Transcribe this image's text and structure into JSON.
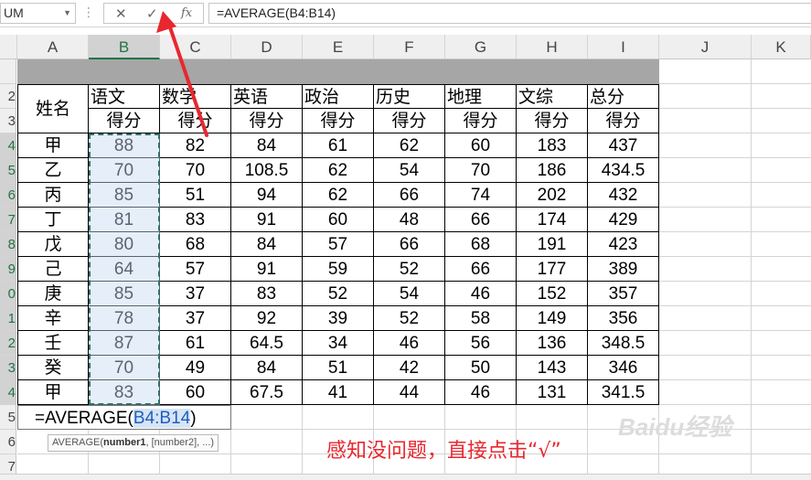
{
  "formula_bar": {
    "name_box": "UM",
    "cancel_symbol": "✕",
    "enter_symbol": "✓",
    "fx_symbol": "fx",
    "formula": "=AVERAGE(B4:B14)"
  },
  "sheet": {
    "columns": [
      "A",
      "B",
      "C",
      "D",
      "E",
      "F",
      "G",
      "H",
      "I",
      "J",
      "K"
    ],
    "row_numbers": [
      "2",
      "3",
      "4",
      "5",
      "6",
      "7",
      "8",
      "9",
      "0",
      "1",
      "2",
      "3",
      "4",
      "5",
      "6",
      "7"
    ],
    "name_header": "姓名",
    "subjects": [
      "语文",
      "数学",
      "英语",
      "政治",
      "历史",
      "地理",
      "文综",
      "总分"
    ],
    "score_label": "得分",
    "rows": [
      {
        "name": "甲",
        "values": [
          "88",
          "82",
          "84",
          "61",
          "62",
          "60",
          "183",
          "437"
        ]
      },
      {
        "name": "乙",
        "values": [
          "70",
          "70",
          "108.5",
          "62",
          "54",
          "70",
          "186",
          "434.5"
        ]
      },
      {
        "name": "丙",
        "values": [
          "85",
          "51",
          "94",
          "62",
          "66",
          "74",
          "202",
          "432"
        ]
      },
      {
        "name": "丁",
        "values": [
          "81",
          "83",
          "91",
          "60",
          "48",
          "66",
          "174",
          "429"
        ]
      },
      {
        "name": "戊",
        "values": [
          "80",
          "68",
          "84",
          "57",
          "66",
          "68",
          "191",
          "423"
        ]
      },
      {
        "name": "己",
        "values": [
          "64",
          "57",
          "91",
          "59",
          "52",
          "66",
          "177",
          "389"
        ]
      },
      {
        "name": "庚",
        "values": [
          "85",
          "37",
          "83",
          "52",
          "54",
          "46",
          "152",
          "357"
        ]
      },
      {
        "name": "辛",
        "values": [
          "78",
          "37",
          "92",
          "39",
          "52",
          "58",
          "149",
          "356"
        ]
      },
      {
        "name": "壬",
        "values": [
          "87",
          "61",
          "64.5",
          "34",
          "46",
          "56",
          "136",
          "348.5"
        ]
      },
      {
        "name": "癸",
        "values": [
          "70",
          "49",
          "84",
          "51",
          "42",
          "50",
          "143",
          "346"
        ]
      },
      {
        "name": "甲",
        "values": [
          "83",
          "60",
          "67.5",
          "41",
          "44",
          "46",
          "131",
          "341.5"
        ]
      }
    ],
    "formula_cell": {
      "prefix": "=AVERAGE(",
      "ref": "B4:B14",
      "suffix": ")"
    },
    "tooltip": {
      "func": "AVERAGE(",
      "arg1": "number1",
      "rest": ", [number2], ...)"
    }
  },
  "annotation": "感知没问题，直接点击“√”",
  "watermark": "Baidu经验",
  "colors": {
    "annotation": "#e8272f",
    "selection": "#2f6f66",
    "header_band": "#a6a6a6",
    "ref_text": "#1f5fbf"
  }
}
